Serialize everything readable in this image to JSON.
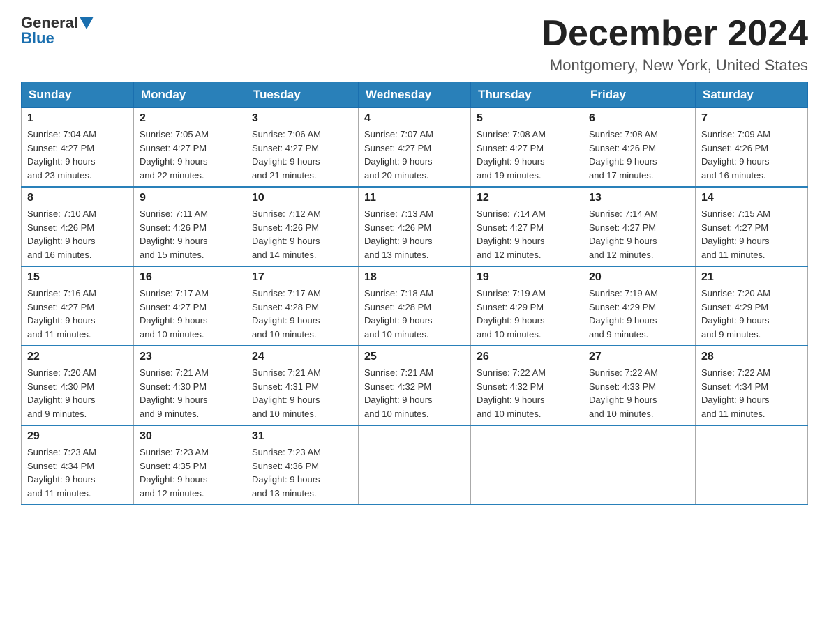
{
  "header": {
    "logo": {
      "general": "General",
      "blue": "Blue"
    },
    "title": "December 2024",
    "location": "Montgomery, New York, United States"
  },
  "days_of_week": [
    "Sunday",
    "Monday",
    "Tuesday",
    "Wednesday",
    "Thursday",
    "Friday",
    "Saturday"
  ],
  "weeks": [
    [
      {
        "day": "1",
        "sunrise": "7:04 AM",
        "sunset": "4:27 PM",
        "daylight": "9 hours and 23 minutes."
      },
      {
        "day": "2",
        "sunrise": "7:05 AM",
        "sunset": "4:27 PM",
        "daylight": "9 hours and 22 minutes."
      },
      {
        "day": "3",
        "sunrise": "7:06 AM",
        "sunset": "4:27 PM",
        "daylight": "9 hours and 21 minutes."
      },
      {
        "day": "4",
        "sunrise": "7:07 AM",
        "sunset": "4:27 PM",
        "daylight": "9 hours and 20 minutes."
      },
      {
        "day": "5",
        "sunrise": "7:08 AM",
        "sunset": "4:27 PM",
        "daylight": "9 hours and 19 minutes."
      },
      {
        "day": "6",
        "sunrise": "7:08 AM",
        "sunset": "4:26 PM",
        "daylight": "9 hours and 17 minutes."
      },
      {
        "day": "7",
        "sunrise": "7:09 AM",
        "sunset": "4:26 PM",
        "daylight": "9 hours and 16 minutes."
      }
    ],
    [
      {
        "day": "8",
        "sunrise": "7:10 AM",
        "sunset": "4:26 PM",
        "daylight": "9 hours and 16 minutes."
      },
      {
        "day": "9",
        "sunrise": "7:11 AM",
        "sunset": "4:26 PM",
        "daylight": "9 hours and 15 minutes."
      },
      {
        "day": "10",
        "sunrise": "7:12 AM",
        "sunset": "4:26 PM",
        "daylight": "9 hours and 14 minutes."
      },
      {
        "day": "11",
        "sunrise": "7:13 AM",
        "sunset": "4:26 PM",
        "daylight": "9 hours and 13 minutes."
      },
      {
        "day": "12",
        "sunrise": "7:14 AM",
        "sunset": "4:27 PM",
        "daylight": "9 hours and 12 minutes."
      },
      {
        "day": "13",
        "sunrise": "7:14 AM",
        "sunset": "4:27 PM",
        "daylight": "9 hours and 12 minutes."
      },
      {
        "day": "14",
        "sunrise": "7:15 AM",
        "sunset": "4:27 PM",
        "daylight": "9 hours and 11 minutes."
      }
    ],
    [
      {
        "day": "15",
        "sunrise": "7:16 AM",
        "sunset": "4:27 PM",
        "daylight": "9 hours and 11 minutes."
      },
      {
        "day": "16",
        "sunrise": "7:17 AM",
        "sunset": "4:27 PM",
        "daylight": "9 hours and 10 minutes."
      },
      {
        "day": "17",
        "sunrise": "7:17 AM",
        "sunset": "4:28 PM",
        "daylight": "9 hours and 10 minutes."
      },
      {
        "day": "18",
        "sunrise": "7:18 AM",
        "sunset": "4:28 PM",
        "daylight": "9 hours and 10 minutes."
      },
      {
        "day": "19",
        "sunrise": "7:19 AM",
        "sunset": "4:29 PM",
        "daylight": "9 hours and 10 minutes."
      },
      {
        "day": "20",
        "sunrise": "7:19 AM",
        "sunset": "4:29 PM",
        "daylight": "9 hours and 9 minutes."
      },
      {
        "day": "21",
        "sunrise": "7:20 AM",
        "sunset": "4:29 PM",
        "daylight": "9 hours and 9 minutes."
      }
    ],
    [
      {
        "day": "22",
        "sunrise": "7:20 AM",
        "sunset": "4:30 PM",
        "daylight": "9 hours and 9 minutes."
      },
      {
        "day": "23",
        "sunrise": "7:21 AM",
        "sunset": "4:30 PM",
        "daylight": "9 hours and 9 minutes."
      },
      {
        "day": "24",
        "sunrise": "7:21 AM",
        "sunset": "4:31 PM",
        "daylight": "9 hours and 10 minutes."
      },
      {
        "day": "25",
        "sunrise": "7:21 AM",
        "sunset": "4:32 PM",
        "daylight": "9 hours and 10 minutes."
      },
      {
        "day": "26",
        "sunrise": "7:22 AM",
        "sunset": "4:32 PM",
        "daylight": "9 hours and 10 minutes."
      },
      {
        "day": "27",
        "sunrise": "7:22 AM",
        "sunset": "4:33 PM",
        "daylight": "9 hours and 10 minutes."
      },
      {
        "day": "28",
        "sunrise": "7:22 AM",
        "sunset": "4:34 PM",
        "daylight": "9 hours and 11 minutes."
      }
    ],
    [
      {
        "day": "29",
        "sunrise": "7:23 AM",
        "sunset": "4:34 PM",
        "daylight": "9 hours and 11 minutes."
      },
      {
        "day": "30",
        "sunrise": "7:23 AM",
        "sunset": "4:35 PM",
        "daylight": "9 hours and 12 minutes."
      },
      {
        "day": "31",
        "sunrise": "7:23 AM",
        "sunset": "4:36 PM",
        "daylight": "9 hours and 13 minutes."
      },
      null,
      null,
      null,
      null
    ]
  ],
  "labels": {
    "sunrise": "Sunrise:",
    "sunset": "Sunset:",
    "daylight": "Daylight:"
  }
}
